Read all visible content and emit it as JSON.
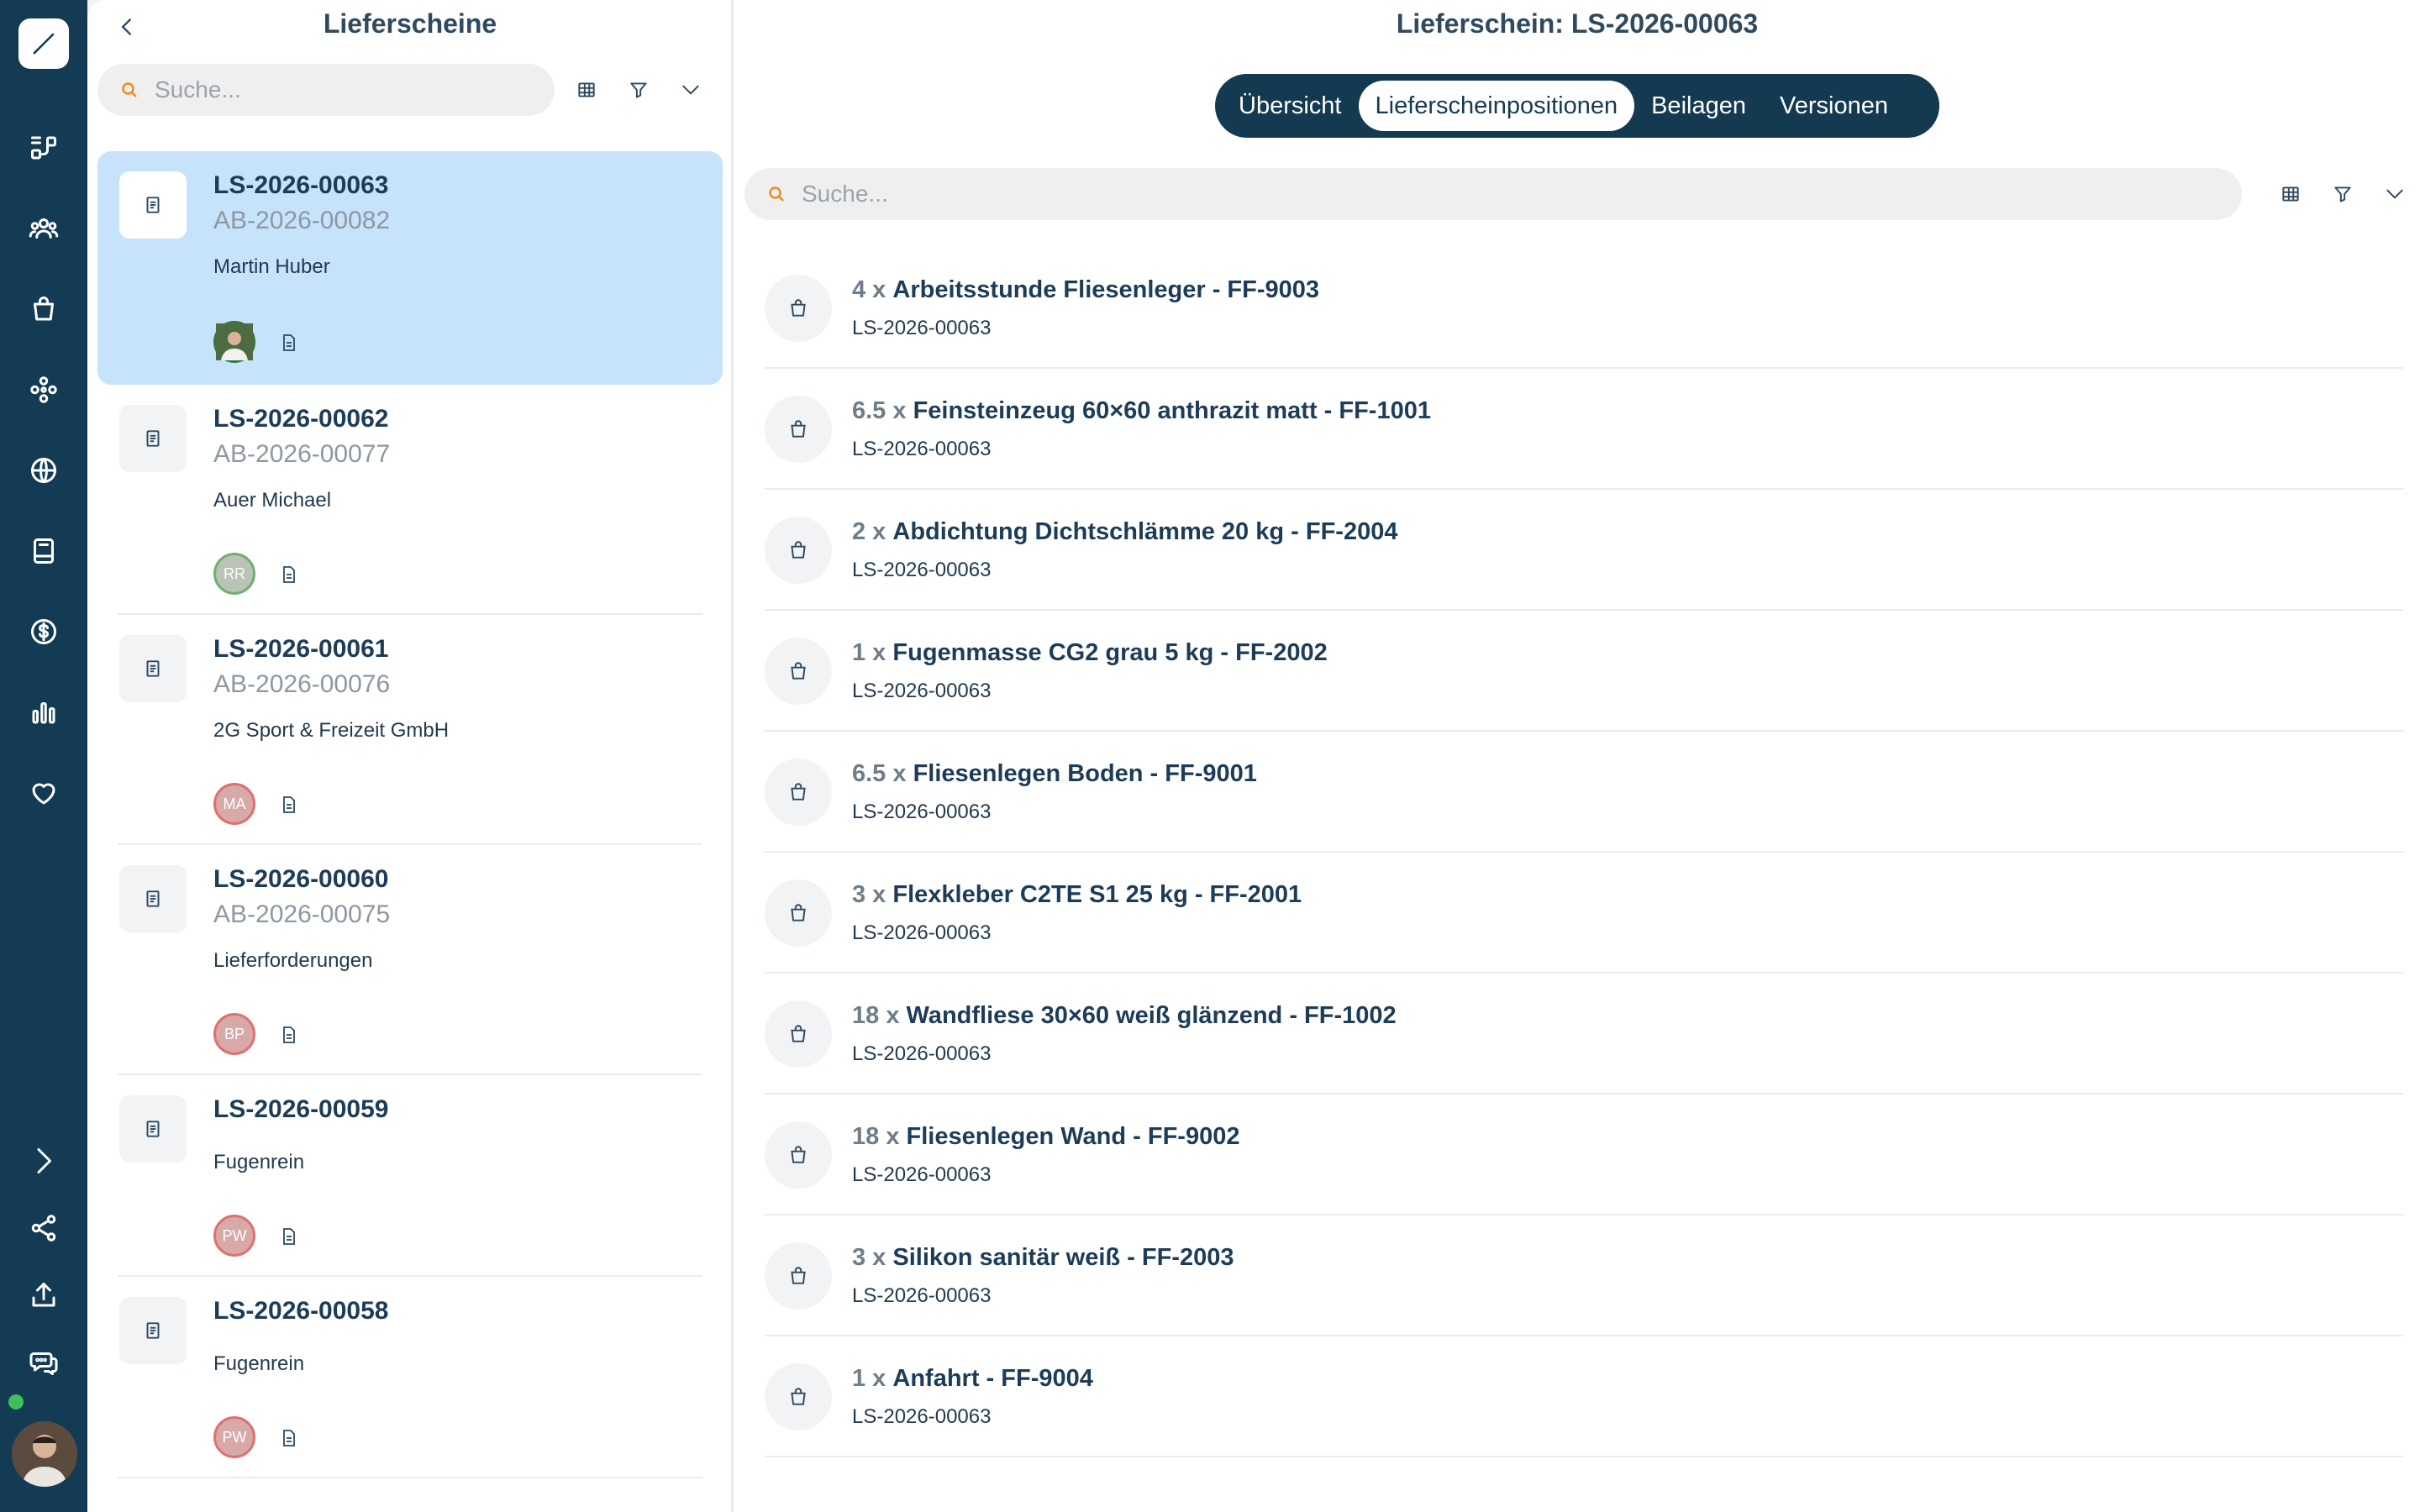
{
  "list": {
    "title": "Lieferscheine",
    "search_placeholder": "Suche...",
    "cards": [
      {
        "number": "LS-2026-00063",
        "order": "AB-2026-00082",
        "customer": "Martin Huber",
        "avatar": ""
      },
      {
        "number": "LS-2026-00062",
        "order": "AB-2026-00077",
        "customer": "Auer Michael",
        "avatar": "RR"
      },
      {
        "number": "LS-2026-00061",
        "order": "AB-2026-00076",
        "customer": "2G Sport & Freizeit GmbH",
        "avatar": "MA"
      },
      {
        "number": "LS-2026-00060",
        "order": "AB-2026-00075",
        "customer": "Lieferforderungen",
        "avatar": "BP"
      },
      {
        "number": "LS-2026-00059",
        "order": "",
        "customer": "Fugenrein",
        "avatar": "PW"
      },
      {
        "number": "LS-2026-00058",
        "order": "",
        "customer": "Fugenrein",
        "avatar": "PW"
      }
    ]
  },
  "detail": {
    "title": "Lieferschein: LS-2026-00063",
    "search_placeholder": "Suche...",
    "tabs": [
      "Übersicht",
      "Lieferscheinpositionen",
      "Beilagen",
      "Versionen"
    ],
    "active_tab": "Lieferscheinpositionen",
    "positions": [
      {
        "qty": "4 x",
        "name": "Arbeitsstunde Fliesenleger - FF-9003",
        "ref": "LS-2026-00063"
      },
      {
        "qty": "6.5 x",
        "name": "Feinsteinzeug 60×60 anthrazit matt - FF-1001",
        "ref": "LS-2026-00063"
      },
      {
        "qty": "2 x",
        "name": "Abdichtung Dichtschlämme 20 kg - FF-2004",
        "ref": "LS-2026-00063"
      },
      {
        "qty": "1 x",
        "name": "Fugenmasse CG2 grau 5 kg - FF-2002",
        "ref": "LS-2026-00063"
      },
      {
        "qty": "6.5 x",
        "name": "Fliesenlegen Boden - FF-9001",
        "ref": "LS-2026-00063"
      },
      {
        "qty": "3 x",
        "name": "Flexkleber C2TE S1 25 kg - FF-2001",
        "ref": "LS-2026-00063"
      },
      {
        "qty": "18 x",
        "name": "Wandfliese 30×60 weiß glänzend - FF-1002",
        "ref": "LS-2026-00063"
      },
      {
        "qty": "18 x",
        "name": "Fliesenlegen Wand - FF-9002",
        "ref": "LS-2026-00063"
      },
      {
        "qty": "3 x",
        "name": "Silikon sanitär weiß - FF-2003",
        "ref": "LS-2026-00063"
      },
      {
        "qty": "1 x",
        "name": "Anfahrt - FF-9004",
        "ref": "LS-2026-00063"
      }
    ]
  },
  "colors": {
    "rail": "#133b53",
    "selected": "#c7e2fb",
    "accent_search": "#f08a1a",
    "online": "#3fbf5a"
  },
  "icons": {
    "rail": [
      "logo-pen-icon",
      "flow-icon",
      "users-icon",
      "shopping-bag-icon",
      "modules-icon",
      "globe-icon",
      "book-icon",
      "dollar-icon",
      "bar-chart-icon",
      "heart-icon",
      "chevron-right-icon",
      "share-icon",
      "upload-icon",
      "chat-icon"
    ]
  }
}
